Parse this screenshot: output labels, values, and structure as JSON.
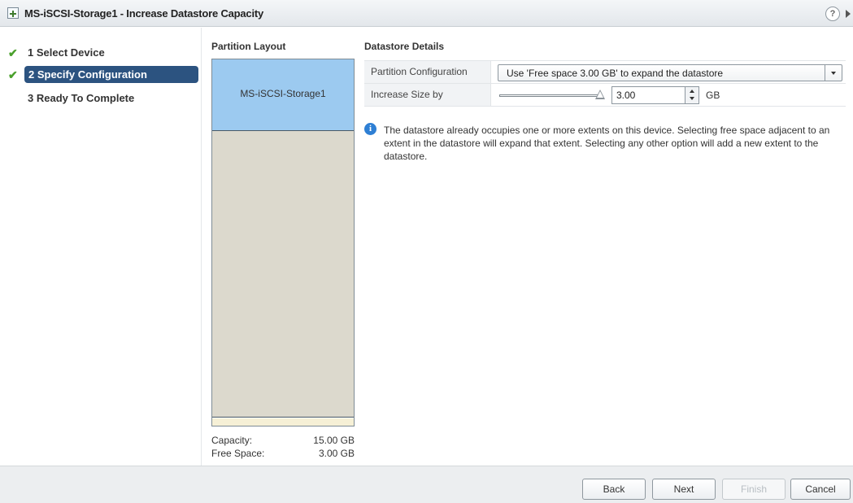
{
  "window": {
    "title": "MS-iSCSI-Storage1 - Increase Datastore Capacity",
    "help_glyph": "?"
  },
  "nav": {
    "steps": [
      {
        "label": "1  Select Device",
        "state": "completed"
      },
      {
        "label": "2  Specify Configuration",
        "state": "active"
      },
      {
        "label": "3  Ready To Complete",
        "state": "pending"
      }
    ]
  },
  "partition_layout": {
    "title": "Partition Layout",
    "used_label": "MS-iSCSI-Storage1",
    "capacity_label": "Capacity:",
    "capacity_value": "15.00 GB",
    "free_label": "Free Space:",
    "free_value": "3.00 GB"
  },
  "datastore_details": {
    "title": "Datastore Details",
    "partition_config_label": "Partition Configuration",
    "partition_config_value": "Use 'Free space 3.00 GB' to expand the datastore",
    "increase_label": "Increase Size by",
    "increase_value": "3.00",
    "increase_unit": "GB",
    "slider_fraction": 1.0,
    "info_text": "The datastore already occupies one or more extents on this device. Selecting free space adjacent to an extent in the datastore will expand that extent. Selecting any other option will add a new extent to the datastore."
  },
  "footer": {
    "back": "Back",
    "next": "Next",
    "finish": "Finish",
    "cancel": "Cancel"
  },
  "colors": {
    "active_step": "#2c5380",
    "used_partition": "#9ccaf0",
    "free_partition": "#dcd9cd",
    "check": "#4aa02c",
    "info": "#2e7fd4"
  },
  "icons": [
    "window-icon",
    "help-icon",
    "collapse-icon",
    "check-icon",
    "info-icon",
    "dropdown-arrow-icon",
    "spin-up-icon",
    "spin-down-icon",
    "slider-thumb-icon"
  ]
}
